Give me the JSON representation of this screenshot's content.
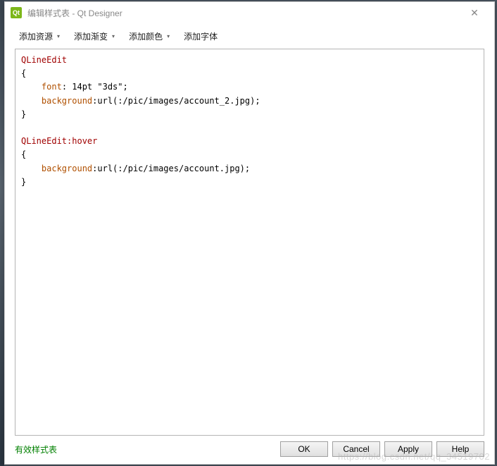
{
  "titlebar": {
    "icon_text": "Qt",
    "title": "编辑样式表 - Qt Designer",
    "close_glyph": "✕"
  },
  "toolbar": {
    "items": [
      {
        "label": "添加资源",
        "has_dropdown": true
      },
      {
        "label": "添加渐变",
        "has_dropdown": true
      },
      {
        "label": "添加颜色",
        "has_dropdown": true
      },
      {
        "label": "添加字体",
        "has_dropdown": false
      }
    ],
    "arrow_glyph": "▾"
  },
  "editor": {
    "lines": [
      {
        "t": "sel",
        "text": "QLineEdit"
      },
      {
        "t": "brace",
        "text": "{"
      },
      {
        "t": "prop2",
        "prop": "font",
        "val": ": 14pt \"3ds\";"
      },
      {
        "t": "prop2",
        "prop": "background",
        "val": ":url(:/pic/images/account_2.jpg);"
      },
      {
        "t": "brace",
        "text": "}"
      },
      {
        "t": "blank",
        "text": ""
      },
      {
        "t": "sel",
        "text": "QLineEdit:hover"
      },
      {
        "t": "brace",
        "text": "{"
      },
      {
        "t": "prop2",
        "prop": "background",
        "val": ":url(:/pic/images/account.jpg);"
      },
      {
        "t": "brace",
        "text": "}"
      }
    ]
  },
  "footer": {
    "status": "有效样式表",
    "buttons": {
      "ok": "OK",
      "cancel": "Cancel",
      "apply": "Apply",
      "help": "Help"
    }
  },
  "watermark": "https://blog.csdn.net/qq_34519702"
}
